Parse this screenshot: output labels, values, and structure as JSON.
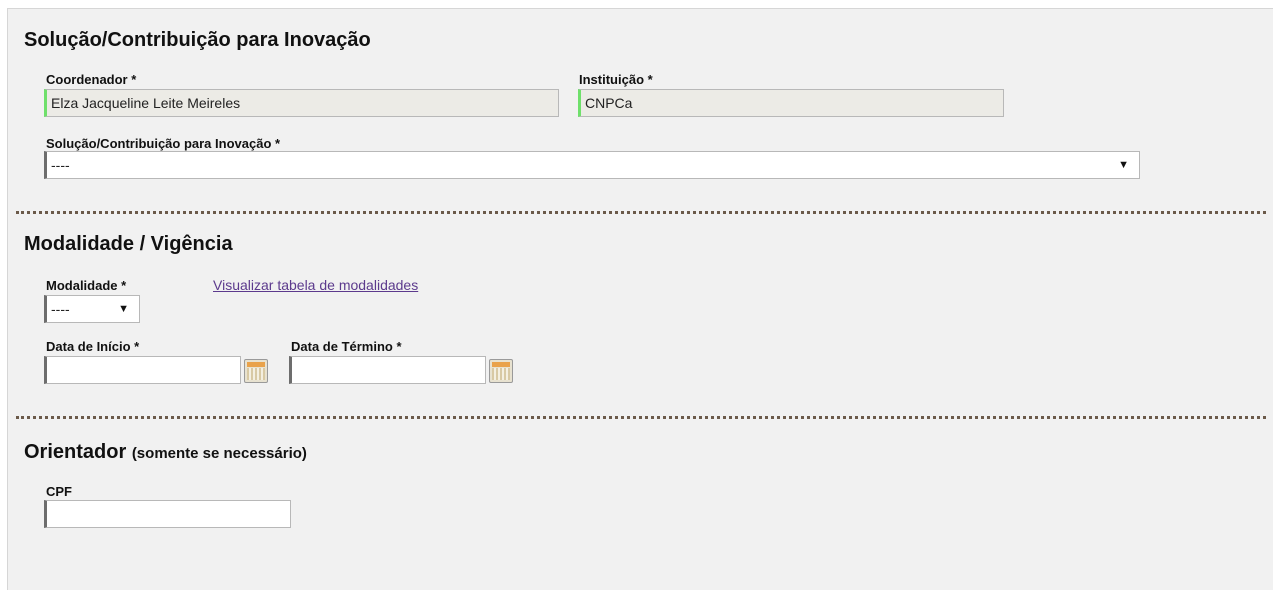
{
  "section_solucao": {
    "title": "Solução/Contribuição para Inovação",
    "coordenador_label": "Coordenador *",
    "coordenador_value": "Elza Jacqueline Leite Meireles",
    "instituicao_label": "Instituição *",
    "instituicao_value": "CNPCa",
    "solucao_label": "Solução/Contribuição para Inovação *",
    "solucao_selected": "----"
  },
  "section_modalidade": {
    "title": "Modalidade / Vigência",
    "modalidade_label": "Modalidade *",
    "modalidade_selected": "----",
    "tabela_link": "Visualizar tabela de modalidades",
    "data_inicio_label": "Data de Início *",
    "data_inicio_value": "",
    "data_termino_label": "Data de Término *",
    "data_termino_value": ""
  },
  "section_orientador": {
    "title": "Orientador",
    "note": "(somente se necessário)",
    "cpf_label": "CPF",
    "cpf_value": ""
  },
  "icons": {
    "select_arrow": "chevron-down-icon",
    "calendar": "calendar-icon"
  },
  "colors": {
    "readonly_marker": "#6fe06b",
    "link": "#5c3a8d"
  }
}
